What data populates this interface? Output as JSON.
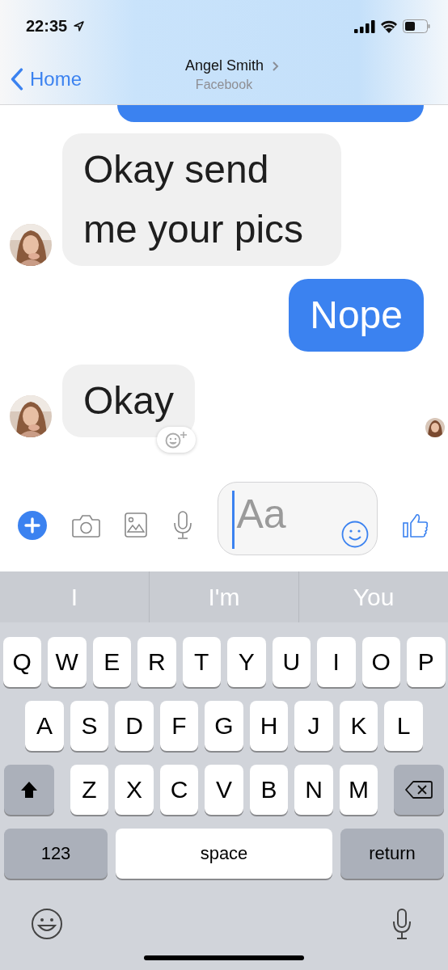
{
  "status_bar": {
    "time": "22:35"
  },
  "nav": {
    "back": "Home",
    "title": "Angel Smith",
    "subtitle": "Facebook"
  },
  "messages": [
    {
      "kind": "incoming",
      "text": "Okay send me your pics",
      "avatar": true,
      "reaction_button": false
    },
    {
      "kind": "outgoing",
      "text": "Nope",
      "avatar": false,
      "reaction_button": false
    },
    {
      "kind": "incoming",
      "text": "Okay",
      "avatar": true,
      "reaction_button": true
    }
  ],
  "composer": {
    "placeholder": "Aa"
  },
  "suggestions": [
    "I",
    "I'm",
    "You"
  ],
  "keyboard": {
    "rows": [
      [
        "Q",
        "W",
        "E",
        "R",
        "T",
        "Y",
        "U",
        "I",
        "O",
        "P"
      ],
      [
        "A",
        "S",
        "D",
        "F",
        "G",
        "H",
        "J",
        "K",
        "L"
      ],
      [
        "Z",
        "X",
        "C",
        "V",
        "B",
        "N",
        "M"
      ]
    ],
    "numbers": "123",
    "space": "space",
    "return": "return"
  }
}
